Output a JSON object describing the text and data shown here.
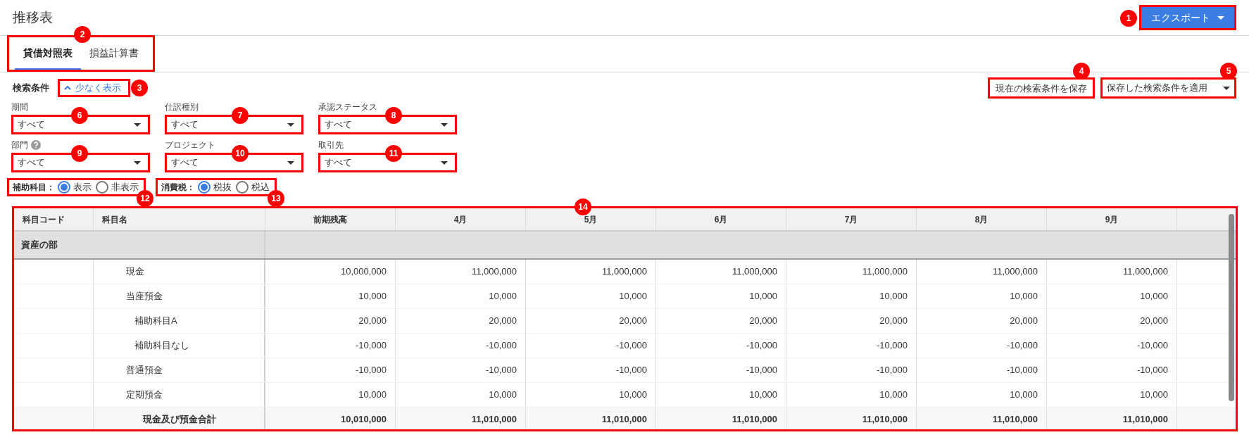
{
  "page_title": "推移表",
  "export_button": {
    "label": "エクスポート",
    "callout": "1"
  },
  "tabs_callout": "2",
  "tabs": [
    {
      "label": "貸借対照表",
      "selected": true
    },
    {
      "label": "損益計算書",
      "selected": false
    }
  ],
  "search": {
    "title": "検索条件",
    "toggle": {
      "label": "少なく表示",
      "expanded": true,
      "callout": "3"
    },
    "save_button": {
      "label": "現在の検索条件を保存",
      "callout": "4"
    },
    "apply_select": {
      "label": "保存した検索条件を適用",
      "callout": "5"
    },
    "filters": [
      {
        "label": "期間",
        "value": "すべて",
        "callout": "6"
      },
      {
        "label": "仕訳種別",
        "value": "すべて",
        "callout": "7"
      },
      {
        "label": "承認ステータス",
        "value": "すべて",
        "callout": "8"
      },
      {
        "label": "部門",
        "value": "すべて",
        "callout": "9",
        "help": true
      },
      {
        "label": "プロジェクト",
        "value": "すべて",
        "callout": "10"
      },
      {
        "label": "取引先",
        "value": "すべて",
        "callout": "11"
      }
    ],
    "radio_groups": [
      {
        "label": "補助科目：",
        "callout": "12",
        "options": [
          {
            "label": "表示",
            "selected": true
          },
          {
            "label": "非表示",
            "selected": false
          }
        ]
      },
      {
        "label": "消費税：",
        "callout": "13",
        "options": [
          {
            "label": "税抜",
            "selected": true
          },
          {
            "label": "税込",
            "selected": false
          }
        ]
      }
    ]
  },
  "table": {
    "callout": "14",
    "columns": [
      "科目コード",
      "科目名",
      "前期残高",
      "4月",
      "5月",
      "6月",
      "7月",
      "8月",
      "9月"
    ],
    "rows": [
      {
        "kind": "section",
        "label": "資産の部"
      },
      {
        "kind": "account",
        "name": "現金",
        "values": [
          "10,000,000",
          "11,000,000",
          "11,000,000",
          "11,000,000",
          "11,000,000",
          "11,000,000",
          "11,000,000"
        ]
      },
      {
        "kind": "account",
        "name": "当座預金",
        "values": [
          "10,000",
          "10,000",
          "10,000",
          "10,000",
          "10,000",
          "10,000",
          "10,000"
        ],
        "children": [
          {
            "kind": "account",
            "name": "補助科目A",
            "values": [
              "20,000",
              "20,000",
              "20,000",
              "20,000",
              "20,000",
              "20,000",
              "20,000"
            ]
          },
          {
            "kind": "account",
            "name": "補助科目なし",
            "values": [
              "-10,000",
              "-10,000",
              "-10,000",
              "-10,000",
              "-10,000",
              "-10,000",
              "-10,000"
            ]
          }
        ]
      },
      {
        "kind": "account",
        "name": "普通預金",
        "values": [
          "-10,000",
          "-10,000",
          "-10,000",
          "-10,000",
          "-10,000",
          "-10,000",
          "-10,000"
        ]
      },
      {
        "kind": "account",
        "name": "定期預金",
        "values": [
          "10,000",
          "10,000",
          "10,000",
          "10,000",
          "10,000",
          "10,000",
          "10,000"
        ]
      },
      {
        "kind": "total",
        "name": "現金及び預金合計",
        "values": [
          "10,010,000",
          "11,010,000",
          "11,010,000",
          "11,010,000",
          "11,010,000",
          "11,010,000",
          "11,010,000"
        ]
      }
    ]
  }
}
